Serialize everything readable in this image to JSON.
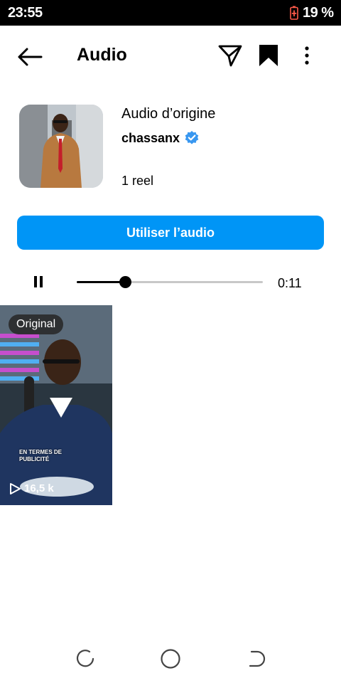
{
  "status_bar": {
    "time": "23:55",
    "battery": "19 %"
  },
  "header": {
    "title": "Audio"
  },
  "audio": {
    "title": "Audio d’origine",
    "artist": "chassanx",
    "reel_count": "1 reel"
  },
  "actions": {
    "use_audio": "Utiliser l’audio"
  },
  "player": {
    "time": "0:11",
    "progress": 0.26
  },
  "reels": [
    {
      "badge": "Original",
      "views": "16,5 k",
      "caption": "EN TERMES DE PUBLICITÉ"
    }
  ],
  "colors": {
    "accent": "#0095f6",
    "verified": "#3897f0"
  },
  "icons": {
    "back": "arrow-left-icon",
    "send": "paper-plane-icon",
    "save": "bookmark-icon",
    "more": "more-vertical-icon",
    "pause": "pause-icon",
    "play": "play-icon",
    "verified": "verified-badge-icon"
  }
}
